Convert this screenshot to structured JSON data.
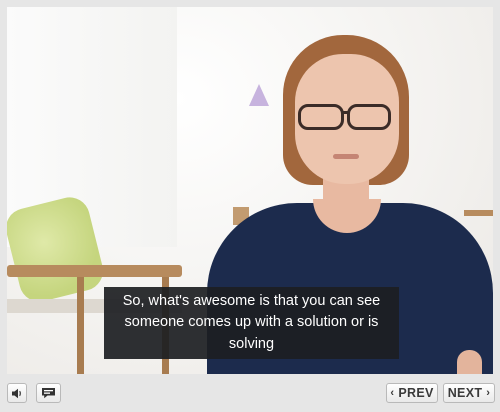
{
  "caption": {
    "text": "So, what's awesome is that you can see someone comes up with a solution or is solving"
  },
  "controls": {
    "volume_icon": "speaker-icon",
    "captions_icon": "captions-icon",
    "prev_label": "PREV",
    "next_label": "NEXT",
    "prev_chevron": "‹",
    "next_chevron": "›"
  },
  "colors": {
    "caption_bg": "#1c1e22",
    "control_bar": "#e6e6e6"
  }
}
